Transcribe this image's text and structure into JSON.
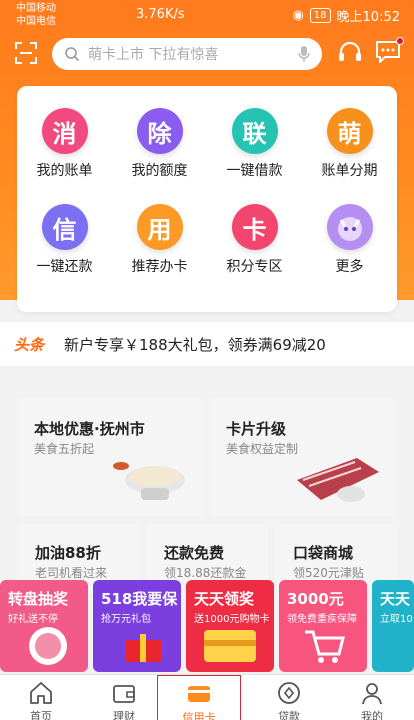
{
  "status": {
    "carrier1": "中国移动",
    "carrier2": "中国电信",
    "speed": "3.76K/s",
    "battery": "18",
    "time": "晚上10:52"
  },
  "search": {
    "placeholder": "萌卡上市 下拉有惊喜"
  },
  "grid": [
    {
      "glyph": "消",
      "label": "我的账单",
      "color": "#f2497e"
    },
    {
      "glyph": "除",
      "label": "我的额度",
      "color": "#8a5cf0"
    },
    {
      "glyph": "联",
      "label": "一键借款",
      "color": "#27c3b2"
    },
    {
      "glyph": "萌",
      "label": "账单分期",
      "color": "#f7911e"
    },
    {
      "glyph": "信",
      "label": "一键还款",
      "color": "#7b6ff2"
    },
    {
      "glyph": "用",
      "label": "推荐办卡",
      "color": "#fb9a24"
    },
    {
      "glyph": "卡",
      "label": "积分专区",
      "color": "#f2466e"
    },
    {
      "glyph": "",
      "label": "更多",
      "color": "#b48ef0"
    }
  ],
  "news": {
    "tag": "头条",
    "text": "新户专享￥188大礼包，领券满69减20"
  },
  "promos": [
    {
      "title": "本地优惠·抚州市",
      "sub": "美食五折起"
    },
    {
      "title": "卡片升级",
      "sub": "美食权益定制"
    }
  ],
  "small": [
    {
      "title": "加油88折",
      "sub": "老司机看过来"
    },
    {
      "title": "还款免费",
      "sub": "领18.88还款金"
    },
    {
      "title": "口袋商城",
      "sub": "领520元津贴"
    }
  ],
  "banners": [
    {
      "title": "转盘抽奖",
      "sub": "好礼送不停",
      "color": "#f25a8a"
    },
    {
      "title": "518我要保",
      "sub": "抢万元礼包",
      "color": "#7b3fe0"
    },
    {
      "title": "天天领奖",
      "sub": "送1000元购物卡",
      "color": "#ee2d45"
    },
    {
      "title": "3000元",
      "sub": "领免费重疾保障",
      "color": "#f7557e"
    },
    {
      "title": "天天",
      "sub": "立取10",
      "color": "#1fb2c8"
    }
  ],
  "tabs": [
    {
      "label": "首页"
    },
    {
      "label": "理财"
    },
    {
      "label": "信用卡"
    },
    {
      "label": "贷款"
    },
    {
      "label": "我的"
    }
  ],
  "colors": {
    "accent": "#ff6a13",
    "hero": "#ff7a1c"
  }
}
